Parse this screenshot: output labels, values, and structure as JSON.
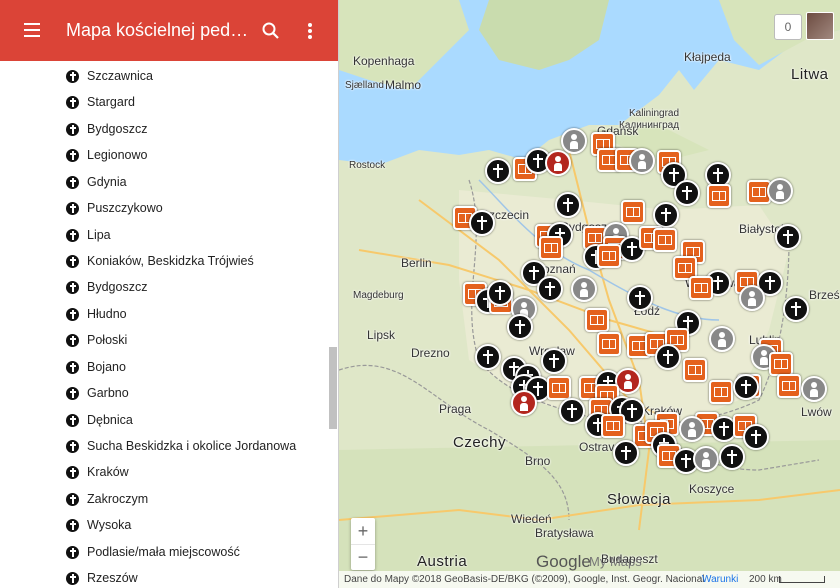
{
  "header": {
    "title": "Mapa kościelnej pedofilii",
    "menu_icon": "hamburger-menu-icon",
    "search_icon": "search-icon",
    "more_icon": "more-vert-icon",
    "color": "#db4437"
  },
  "sidebar": {
    "items": [
      {
        "label": "Szczawnica"
      },
      {
        "label": "Stargard"
      },
      {
        "label": "Bydgoszcz"
      },
      {
        "label": "Legionowo"
      },
      {
        "label": "Gdynia"
      },
      {
        "label": "Puszczykowo"
      },
      {
        "label": "Lipa"
      },
      {
        "label": "Koniaków, Beskidzka Trójwieś"
      },
      {
        "label": "Bydgoszcz"
      },
      {
        "label": "Hłudno"
      },
      {
        "label": "Połoski"
      },
      {
        "label": "Bojano"
      },
      {
        "label": "Garbno"
      },
      {
        "label": "Dębnica"
      },
      {
        "label": "Sucha Beskidzka i okolice Jordanowa"
      },
      {
        "label": "Kraków"
      },
      {
        "label": "Zakroczym"
      },
      {
        "label": "Wysoka"
      },
      {
        "label": "Podlasie/mała miejscowość"
      },
      {
        "label": "Rzeszów"
      }
    ]
  },
  "map": {
    "labels": {
      "kopenhaga": "Kopenhaga",
      "sjaelland": "Sjælland",
      "malmo": "Malmo",
      "klajpeda": "Kłajpeda",
      "litwa": "Litwa",
      "kaliningrad_pl": "Kaliningrad",
      "kaliningrad_ru": "Калининград",
      "rostock": "Rostock",
      "szczecin": "Szczecin",
      "bydgoszcz": "Bydgoszcz",
      "bialystok": "Białystok",
      "berlin": "Berlin",
      "poznan": "Poznań",
      "magdeburg": "Magdeburg",
      "lodz": "Łódź",
      "lipsk": "Lipsk",
      "drezno": "Drezno",
      "wroclaw": "Wrocław",
      "lublin": "Lublin",
      "lwow": "Lwów",
      "praga": "Praga",
      "krakow": "Kraków",
      "czechy": "Czechy",
      "ostrava": "Ostrava",
      "brno": "Brno",
      "slowacja": "Słowacja",
      "koszyce": "Koszyce",
      "wieden": "Wiedeń",
      "bratyslawa": "Bratysława",
      "budapeszt": "Budapeszt",
      "austria": "Austria",
      "gdansk": "Gdańsk",
      "warszawa": "Warszawa",
      "brzesc": "Brześć"
    },
    "counter": "0",
    "zoom_in": "+",
    "zoom_out": "−",
    "google": "Google",
    "my_maps": "My Maps",
    "attribution": "Dane do Mapy ©2018 GeoBasis-DE/BKG (©2009), Google, Inst. Geogr. Nacional",
    "terms": "Warunki",
    "scale": "200 km",
    "colors": {
      "orange": "#e4611d",
      "black": "#111111",
      "grey": "#888888",
      "red": "#b3261e"
    }
  }
}
